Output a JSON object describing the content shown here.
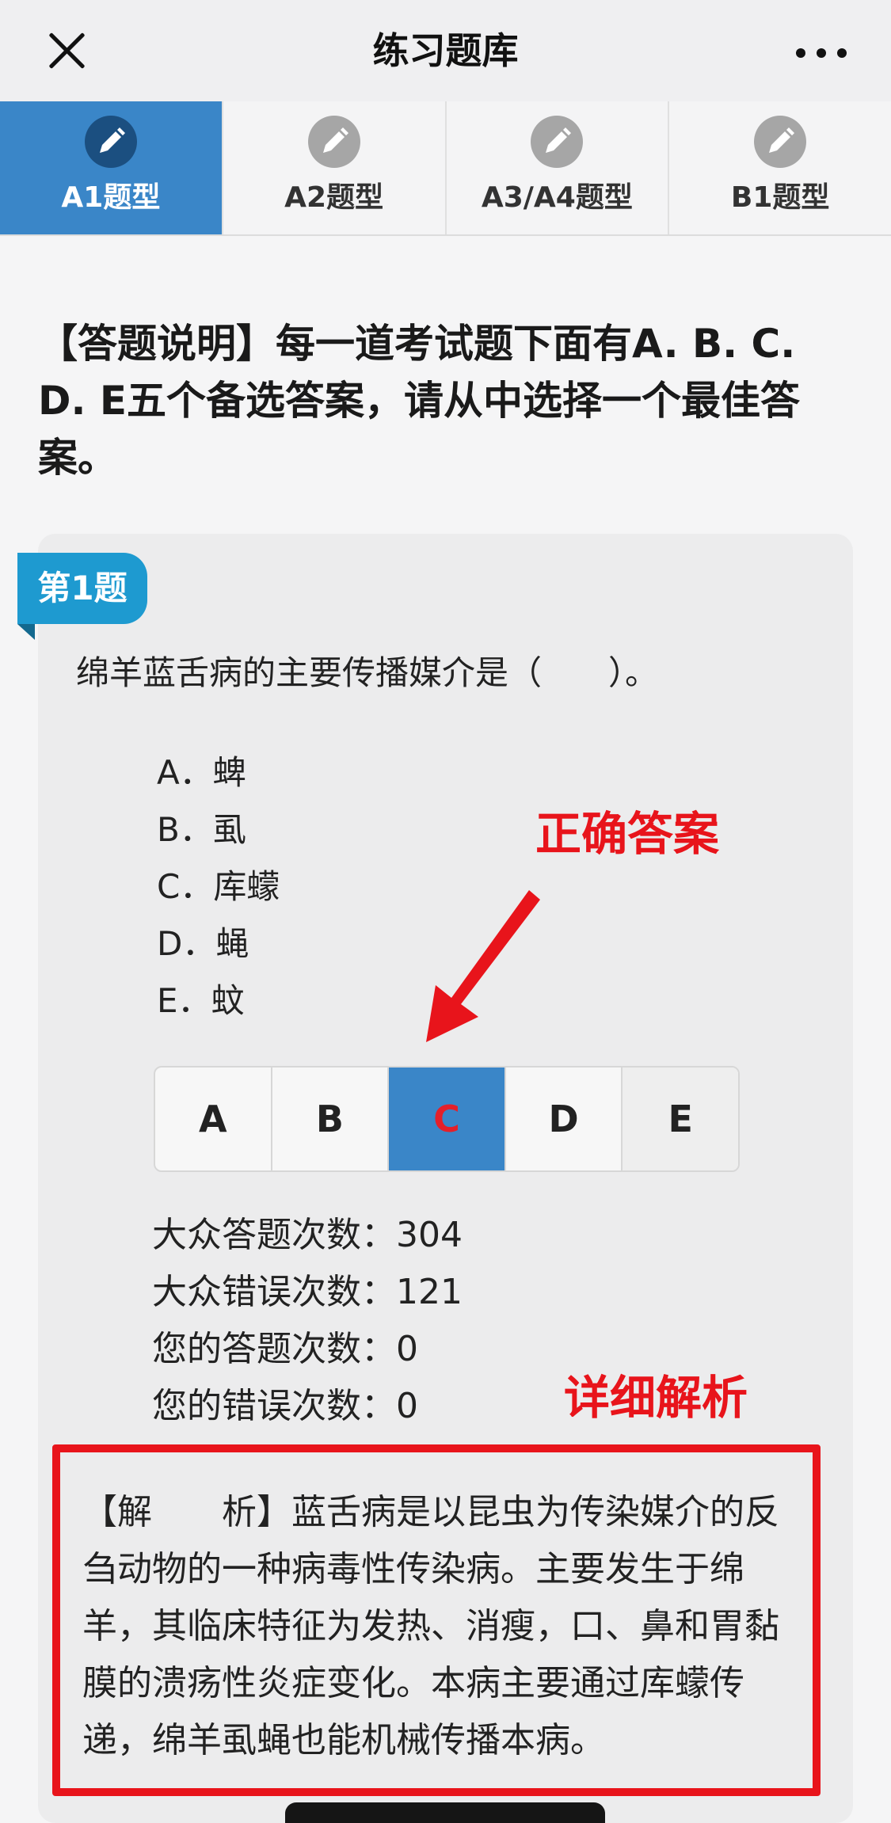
{
  "header": {
    "title": "练习题库",
    "close_icon": "close-icon",
    "more_icon": "more-icon"
  },
  "tabs": [
    {
      "label": "A1题型",
      "icon": "pencil-icon",
      "active": true
    },
    {
      "label": "A2题型",
      "icon": "pencil-icon",
      "active": false
    },
    {
      "label": "A3/A4题型",
      "icon": "pencil-icon",
      "active": false
    },
    {
      "label": "B1题型",
      "icon": "pencil-icon",
      "active": false
    }
  ],
  "instructions": "【答题说明】每一道考试题下面有A. B. C. D. E五个备选答案，请从中选择一个最佳答案。",
  "question": {
    "badge": "第1题",
    "text": "绵羊蓝舌病的主要传播媒介是（　　）。",
    "options": [
      "A．蜱",
      "B．虱",
      "C．库蠓",
      "D．蝇",
      "E．蚊"
    ]
  },
  "answer_buttons": [
    {
      "label": "A",
      "selected": false
    },
    {
      "label": "B",
      "selected": false
    },
    {
      "label": "C",
      "selected": true
    },
    {
      "label": "D",
      "selected": false
    },
    {
      "label": "E",
      "selected": false
    }
  ],
  "stats": [
    "大众答题次数：304",
    "大众错误次数：121",
    "您的答题次数：0",
    "您的错误次数：0"
  ],
  "annotations": {
    "correct_answer": "正确答案",
    "detailed_analysis": "详细解析"
  },
  "explanation": "【解　　析】蓝舌病是以昆虫为传染媒介的反刍动物的一种病毒性传染病。主要发生于绵羊，其临床特征为发热、消瘦，口、鼻和胃黏膜的溃疡性炎症变化。本病主要通过库蠓传递，绵羊虱蝇也能机械传播本病。",
  "colors": {
    "accent": "#3a86c8",
    "badge": "#1e9ad0",
    "annotation": "#e8141b"
  }
}
